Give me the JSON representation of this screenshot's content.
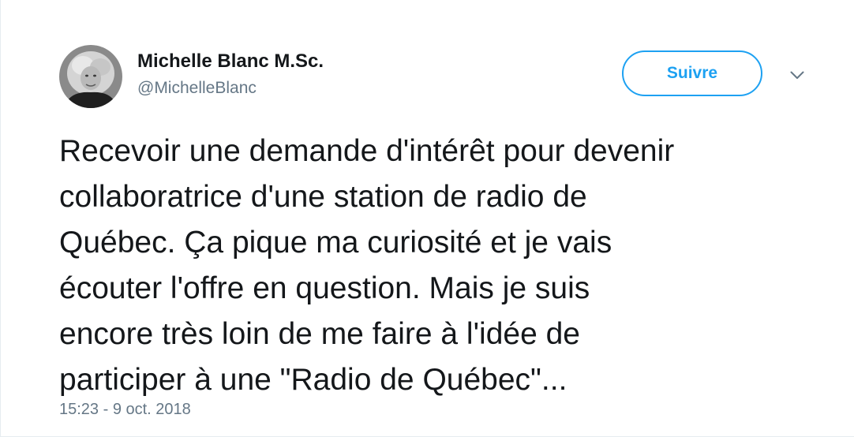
{
  "author": {
    "display_name": "Michelle Blanc M.Sc.",
    "handle": "@MichelleBlanc"
  },
  "actions": {
    "follow_label": "Suivre",
    "menu_icon": "chevron-down-icon"
  },
  "tweet": {
    "lines": [
      "Recevoir une demande d'intérêt pour devenir",
      "collaboratrice d'une station de radio de",
      "Québec. Ça pique ma curiosité et je vais",
      "écouter l'offre en question. Mais je suis",
      "encore très loin de me faire à l'idée de",
      "participer à une \"Radio de Québec\"..."
    ],
    "timestamp": "15:23 - 9 oct. 2018"
  },
  "colors": {
    "accent": "#1da1f2",
    "text": "#14171a",
    "secondary_text": "#657786"
  }
}
